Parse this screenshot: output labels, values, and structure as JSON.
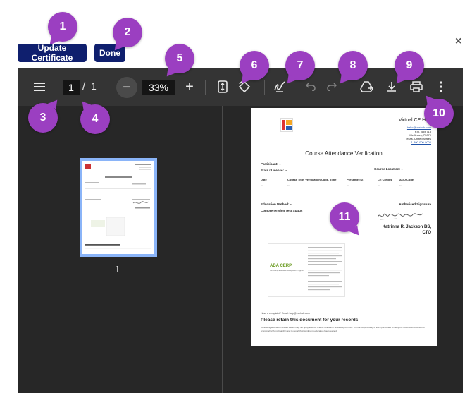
{
  "buttons": {
    "update_certificate": "Update Certificate",
    "done": "Done"
  },
  "close": "×",
  "toolbar": {
    "page_current": "1",
    "page_sep": "/",
    "page_total": "1",
    "zoom_minus": "−",
    "zoom": "33%",
    "zoom_plus": "+",
    "icons": [
      "menu-icon",
      "fit-page-icon",
      "rotate-icon",
      "annotate-icon",
      "undo-icon",
      "redo-icon",
      "add-to-drive-icon",
      "download-icon",
      "print-icon",
      "more-vert-icon"
    ]
  },
  "thumbnail": {
    "label": "1"
  },
  "document": {
    "org_name": "Virtual CE Hub",
    "org_email": "hello@vcehub.com",
    "org_addr1": "P.O. Box 713",
    "org_addr2": "McKinney, 75070",
    "org_addr3": "Texas, United States",
    "org_phone": "1-800-000-0000",
    "title": "Course Attendance Verification",
    "participant": "Participant: --",
    "state": "State / License: --",
    "course_location": "Course Location: --",
    "columns": [
      "Date",
      "Course Title, Verification Code, Time",
      "Presenter(s)",
      "CE Credits",
      "AGD Code"
    ],
    "cells": [
      "--",
      "--",
      "--",
      "--",
      "--"
    ],
    "education_method": "Education Method: --",
    "comprehension": "Comprehension Test Status",
    "auth_sig": "Authorised Signature",
    "signer": "Katrinna R. Jackson BS,",
    "signer_title": "CTO",
    "ada_logo": "ADA CERP",
    "ada_sub": "Continuing Education Recognition Program",
    "complaint": "Have a complaint? Email: help@vcehub.com",
    "retain": "Please retain this document for your records",
    "footer": "Continuing Education Credits issued may not apply towards license renewal in all states/provinces. It is the responsibility of each participant to verify the requirements of his/her licensing/certifying board(s) and to report their continuing education hours earned."
  },
  "callouts": [
    "1",
    "2",
    "3",
    "4",
    "5",
    "6",
    "7",
    "8",
    "9",
    "10",
    "11"
  ],
  "colors": {
    "button_bg": "#0f1f6e",
    "callout": "#9b3fc1",
    "viewer_bg": "#272727",
    "toolbar_bg": "#343434",
    "thumb_border": "#8ab4f8"
  }
}
